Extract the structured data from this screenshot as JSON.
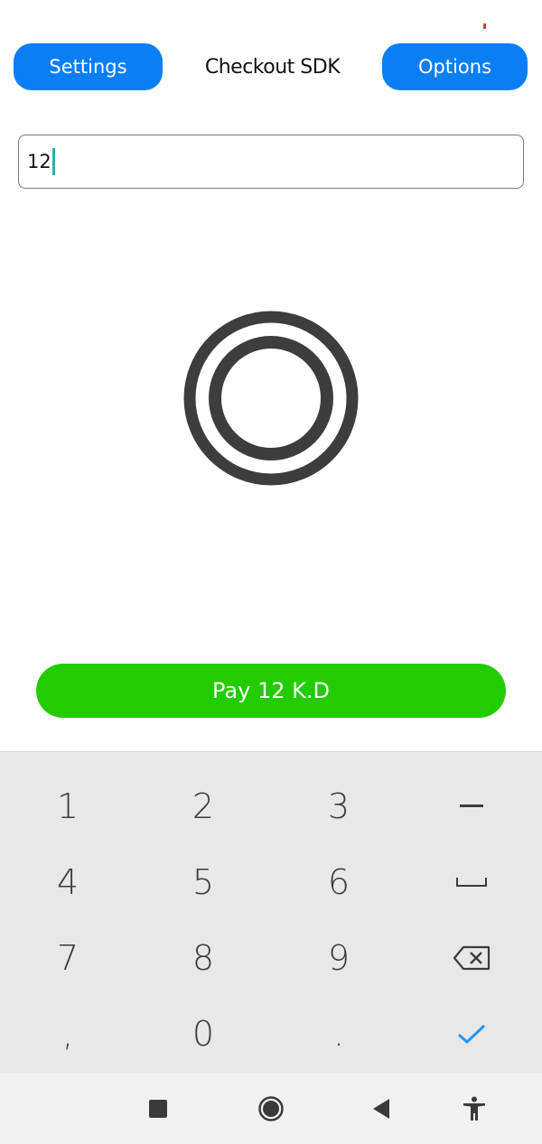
{
  "header": {
    "settings_label": "Settings",
    "title": "Checkout SDK",
    "options_label": "Options"
  },
  "amount_field": {
    "value": "12"
  },
  "pay_button": {
    "label": "Pay 12 K.D"
  },
  "keyboard": {
    "keys": [
      "1",
      "2",
      "3",
      "−",
      "4",
      "5",
      "6",
      "␣",
      "7",
      "8",
      "9",
      "⌫",
      ",",
      "0",
      ".",
      "✓"
    ],
    "key_names": [
      "key-1",
      "key-2",
      "key-3",
      "key-minus",
      "key-4",
      "key-5",
      "key-6",
      "key-space",
      "key-7",
      "key-8",
      "key-9",
      "key-backspace",
      "key-comma",
      "key-0",
      "key-period",
      "key-done"
    ]
  },
  "navbar": {
    "icons": [
      "recent-apps-icon",
      "home-icon",
      "back-icon",
      "accessibility-icon"
    ]
  },
  "colors": {
    "primary": "#0a7ef5",
    "pay": "#22cc00",
    "cursor": "#1fb5a9",
    "check": "#2196f3"
  }
}
